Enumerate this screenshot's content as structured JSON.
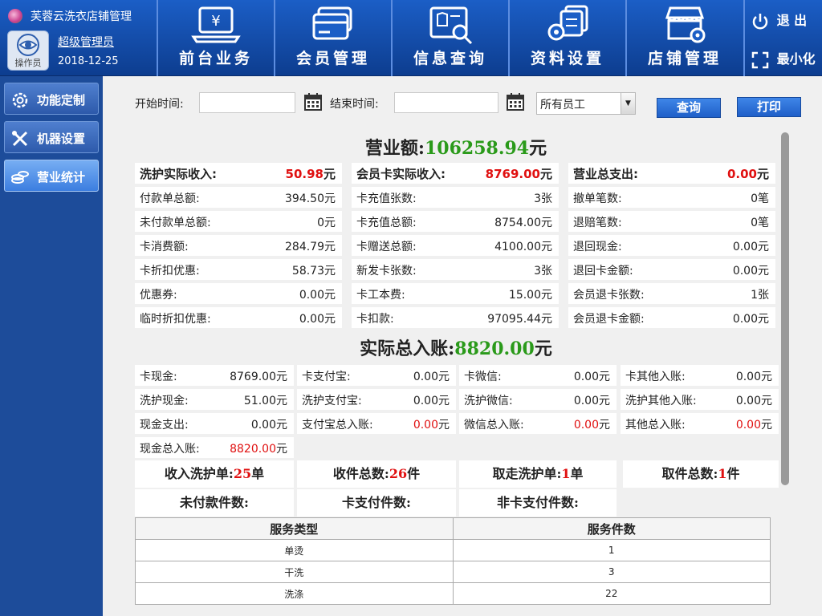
{
  "app": {
    "title": "芙蓉云洗衣店铺管理",
    "user": "超级管理员",
    "role": "操作员",
    "date": "2018-12-25"
  },
  "nav": [
    {
      "label": "前台业务",
      "icon": "laptop-yen-icon"
    },
    {
      "label": "会员管理",
      "icon": "member-card-icon"
    },
    {
      "label": "信息查询",
      "icon": "info-search-icon"
    },
    {
      "label": "资料设置",
      "icon": "data-settings-icon"
    },
    {
      "label": "店铺管理",
      "icon": "store-settings-icon"
    }
  ],
  "sys": {
    "exit": "退 出",
    "minimize": "最小化"
  },
  "sidebar": [
    {
      "label": "功能定制",
      "icon": "gear-icon",
      "active": false
    },
    {
      "label": "机器设置",
      "icon": "tools-icon",
      "active": false
    },
    {
      "label": "营业统计",
      "icon": "coins-icon",
      "active": true
    }
  ],
  "filter": {
    "start_label": "开始时间:",
    "start_value": "",
    "end_label": "结束时间:",
    "end_value": "",
    "staff": "所有员工",
    "query": "查询",
    "print": "打印"
  },
  "revenue": {
    "label": "营业额:",
    "value": "106258.94",
    "unit": "元"
  },
  "col1": {
    "head": {
      "label": "洗护实际收入:",
      "value": "50.98",
      "unit": "元"
    },
    "rows": [
      {
        "label": "付款单总额:",
        "value": "394.50元"
      },
      {
        "label": "未付款单总额:",
        "value": "0元"
      },
      {
        "label": "卡消费额:",
        "value": "284.79元"
      },
      {
        "label": "卡折扣优惠:",
        "value": "58.73元"
      },
      {
        "label": "优惠券:",
        "value": "0.00元"
      },
      {
        "label": "临时折扣优惠:",
        "value": "0.00元"
      }
    ]
  },
  "col2": {
    "head": {
      "label": "会员卡实际收入:",
      "value": "8769.00",
      "unit": "元"
    },
    "rows": [
      {
        "label": "卡充值张数:",
        "value": "3张"
      },
      {
        "label": "卡充值总额:",
        "value": "8754.00元"
      },
      {
        "label": "卡赠送总额:",
        "value": "4100.00元"
      },
      {
        "label": "新发卡张数:",
        "value": "3张"
      },
      {
        "label": "卡工本费:",
        "value": "15.00元"
      },
      {
        "label": "卡扣款:",
        "value": "97095.44元"
      }
    ]
  },
  "col3": {
    "head": {
      "label": "营业总支出:",
      "value": "0.00",
      "unit": "元"
    },
    "rows": [
      {
        "label": "撤单笔数:",
        "value": "0笔"
      },
      {
        "label": "退赔笔数:",
        "value": "0笔"
      },
      {
        "label": "退回现金:",
        "value": "0.00元"
      },
      {
        "label": "退回卡金额:",
        "value": "0.00元"
      },
      {
        "label": "会员退卡张数:",
        "value": "1张"
      },
      {
        "label": "会员退卡金额:",
        "value": "0.00元"
      }
    ]
  },
  "actual": {
    "label": "实际总入账:",
    "value": "8820.00",
    "unit": "元"
  },
  "ledger": [
    [
      {
        "label": "卡现金:",
        "value": "8769.00元"
      },
      {
        "label": "卡支付宝:",
        "value": "0.00元"
      },
      {
        "label": "卡微信:",
        "value": "0.00元"
      },
      {
        "label": "卡其他入账:",
        "value": "0.00元"
      }
    ],
    [
      {
        "label": "洗护现金:",
        "value": "51.00元"
      },
      {
        "label": "洗护支付宝:",
        "value": "0.00元"
      },
      {
        "label": "洗护微信:",
        "value": "0.00元"
      },
      {
        "label": "洗护其他入账:",
        "value": "0.00元"
      }
    ],
    [
      {
        "label": "现金支出:",
        "value": "0.00元"
      },
      {
        "label": "支付宝总入账:",
        "value": "0.00",
        "unit": "元"
      },
      {
        "label": "微信总入账:",
        "value": "0.00",
        "unit": "元"
      },
      {
        "label": "其他总入账:",
        "value": "0.00",
        "unit": "元"
      }
    ],
    [
      {
        "label": "现金总入账:",
        "value": "8820.00",
        "unit": "元"
      }
    ]
  ],
  "counts": [
    {
      "label": "收入洗护单:",
      "value": "25",
      "unit": "单"
    },
    {
      "label": "收件总数:",
      "value": "26",
      "unit": "件"
    },
    {
      "label": "取走洗护单:",
      "value": "1",
      "unit": "单"
    },
    {
      "label": "取件总数:",
      "value": "1",
      "unit": "件"
    }
  ],
  "counts2": [
    {
      "label": "未付款件数:"
    },
    {
      "label": "卡支付件数:"
    },
    {
      "label": "非卡支付件数:"
    }
  ],
  "service_table": {
    "headers": [
      "服务类型",
      "服务件数"
    ],
    "rows": [
      [
        "单烫",
        "1"
      ],
      [
        "干洗",
        "3"
      ],
      [
        "洗涤",
        "22"
      ]
    ]
  }
}
